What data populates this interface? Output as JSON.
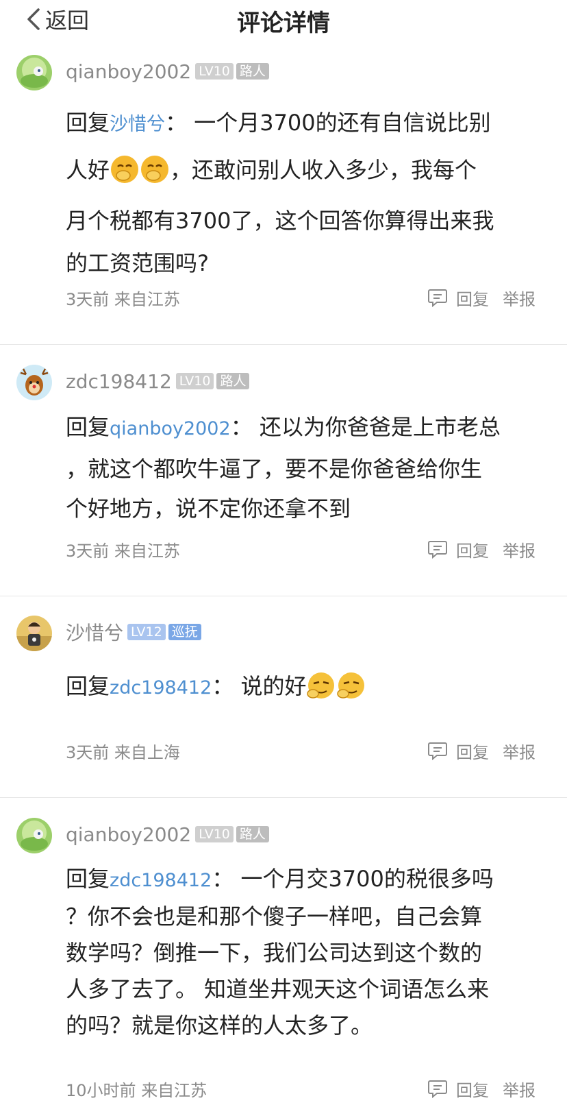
{
  "header": {
    "back_label": "返回",
    "title": "评论详情"
  },
  "colors": {
    "mention": "#4e8fd0",
    "lv_gray": "#cfcfcf",
    "lv_blue": "#a9c4ef",
    "role_gray": "#bdbdbd",
    "role_blue": "#7aa7e6"
  },
  "comments": [
    {
      "username": "qianboy2002",
      "level": "LV10",
      "role": "路人",
      "reply_prefix": "回复",
      "reply_to": "沙惜兮",
      "colon": "：",
      "lines": [
        "一个月3700的还有自信说比别",
        "人好",
        "，还敢问别人收入多少，我每个",
        "月个税都有3700了，这个回答你算得出来我",
        "的工资范围吗?"
      ],
      "time": "3天前",
      "location": "来自江苏",
      "reply_label": "回复",
      "report_label": "举报"
    },
    {
      "username": "zdc198412",
      "level": "LV10",
      "role": "路人",
      "reply_prefix": "回复",
      "reply_to": "qianboy2002",
      "colon": "：",
      "lines": [
        "还以为你爸爸是上市老总",
        "，就这个都吹牛逼了，要不是你爸爸给你生",
        "个好地方，说不定你还拿不到"
      ],
      "time": "3天前",
      "location": "来自江苏",
      "reply_label": "回复",
      "report_label": "举报"
    },
    {
      "username": "沙惜兮",
      "level": "LV12",
      "role": "巡抚",
      "reply_prefix": "回复",
      "reply_to": "zdc198412",
      "colon": "：",
      "lines": [
        "说的好"
      ],
      "time": "3天前",
      "location": "来自上海",
      "reply_label": "回复",
      "report_label": "举报"
    },
    {
      "username": "qianboy2002",
      "level": "LV10",
      "role": "路人",
      "reply_prefix": "回复",
      "reply_to": "zdc198412",
      "colon": "：",
      "lines": [
        "一个月交3700的税很多吗",
        "？你不会也是和那个傻子一样吧，自己会算",
        "数学吗？倒推一下，我们公司达到这个数的",
        "人多了去了。 知道坐井观天这个词语怎么来",
        "的吗？就是你这样的人太多了。"
      ],
      "time": "10小时前",
      "location": "来自江苏",
      "reply_label": "回复",
      "report_label": "举报"
    }
  ]
}
